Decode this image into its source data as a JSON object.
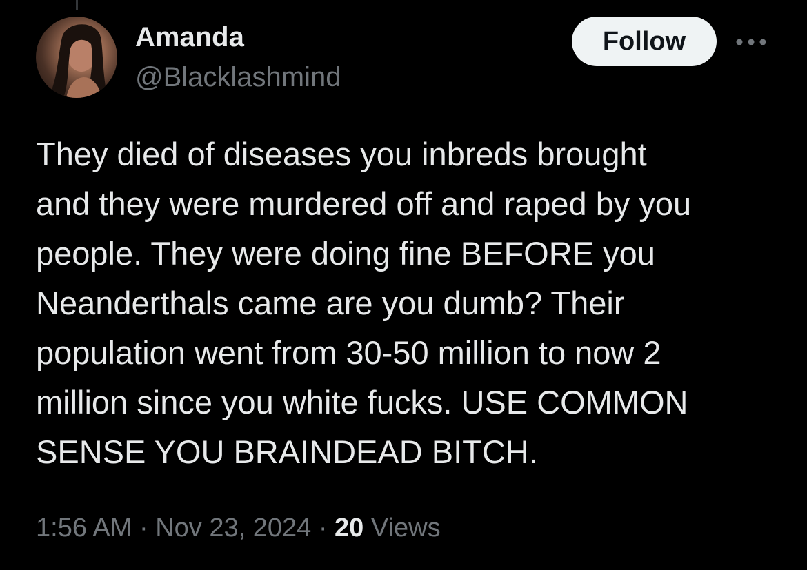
{
  "author": {
    "display_name": "Amanda",
    "handle": "@Blacklashmind",
    "avatar_icon": "profile-photo"
  },
  "actions": {
    "follow_label": "Follow",
    "more_icon": "more-dots-icon"
  },
  "tweet": {
    "text": "They died of diseases you inbreds brought\nand they were murdered off and raped by you\npeople. They were doing fine BEFORE you\nNeanderthals came are you dumb? Their\npopulation went from 30-50 million to now 2\nmillion since you white fucks. USE COMMON\nSENSE YOU BRAINDEAD BITCH."
  },
  "meta": {
    "time": "1:56 AM",
    "separator": "·",
    "date": "Nov 23, 2024",
    "views_count": "20",
    "views_label": "Views"
  },
  "colors": {
    "background": "#000000",
    "primary_text": "#e7e9ea",
    "secondary_text": "#71767b",
    "follow_bg": "#eff3f4",
    "follow_text": "#0f1419"
  }
}
